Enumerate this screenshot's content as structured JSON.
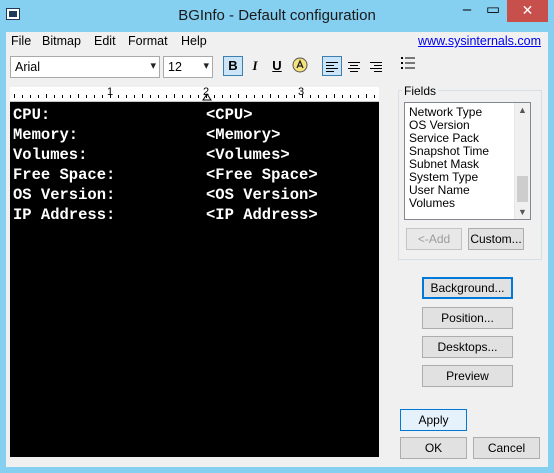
{
  "window": {
    "title": "BGInfo - Default configuration",
    "minimize": "–",
    "maximize": "▭",
    "close": "✕"
  },
  "menu": {
    "items": [
      "File",
      "Bitmap",
      "Edit",
      "Format",
      "Help"
    ],
    "link": "www.sysinternals.com"
  },
  "toolbar": {
    "font": "Arial",
    "size": "12",
    "bold": "B",
    "italic": "I",
    "underline": "U",
    "dropdown_arrow": "▾"
  },
  "ruler": {
    "numbers": [
      "1",
      "2",
      "3"
    ]
  },
  "editor": {
    "lines": [
      {
        "label": "CPU:",
        "value": "<CPU>"
      },
      {
        "label": "Memory:",
        "value": "<Memory>"
      },
      {
        "label": "Volumes:",
        "value": "<Volumes>"
      },
      {
        "label": "Free Space:",
        "value": "<Free Space>"
      },
      {
        "label": "OS Version:",
        "value": "<OS Version>"
      },
      {
        "label": "IP Address:",
        "value": "<IP Address>"
      }
    ]
  },
  "fields": {
    "label": "Fields",
    "items": [
      "Network Type",
      "OS Version",
      "Service Pack",
      "Snapshot Time",
      "Subnet Mask",
      "System Type",
      "User Name",
      "Volumes"
    ],
    "add_label": "<-Add",
    "custom_label": "Custom..."
  },
  "buttons": {
    "background": "Background...",
    "position": "Position...",
    "desktops": "Desktops...",
    "preview": "Preview",
    "apply": "Apply",
    "ok": "OK",
    "cancel": "Cancel"
  }
}
